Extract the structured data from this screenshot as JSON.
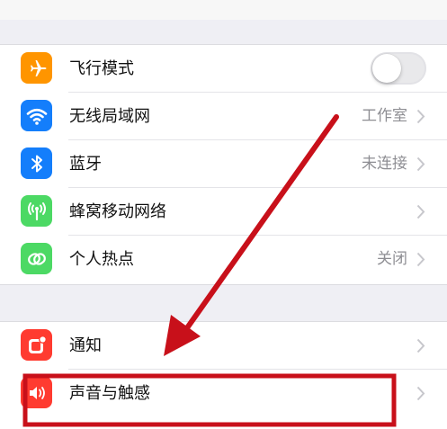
{
  "colors": {
    "airplane": "#ff9500",
    "wifi": "#147efb",
    "bluetooth": "#147efb",
    "cellular": "#4cd964",
    "hotspot": "#4cd964",
    "notifications": "#ff3b30",
    "sounds": "#ff3b30",
    "annotation": "#c8101a"
  },
  "settings": {
    "airplane": {
      "label": "飞行模式",
      "icon": "airplane-icon",
      "toggle_on": false
    },
    "wifi": {
      "label": "无线局域网",
      "value": "工作室",
      "icon": "wifi-icon"
    },
    "bluetooth": {
      "label": "蓝牙",
      "value": "未连接",
      "icon": "bluetooth-icon"
    },
    "cellular": {
      "label": "蜂窝移动网络",
      "icon": "cellular-antenna-icon"
    },
    "hotspot": {
      "label": "个人热点",
      "value": "关闭",
      "icon": "hotspot-link-icon"
    },
    "notifications": {
      "label": "通知",
      "icon": "notifications-icon"
    },
    "sounds": {
      "label": "声音与触感",
      "icon": "speaker-icon"
    }
  }
}
